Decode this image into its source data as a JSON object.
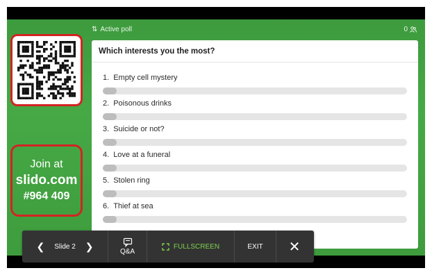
{
  "topbar": {
    "sort_icon": "sort-arrows-icon",
    "status": "Active poll",
    "participant_count": "0",
    "participants_icon": "people-icon"
  },
  "join": {
    "line1": "Join at",
    "line2": "slido.com",
    "line3": "#964 409"
  },
  "poll": {
    "question": "Which interests you the most?",
    "options": [
      {
        "number": "1.",
        "label": "Empty cell mystery",
        "fraction": 0
      },
      {
        "number": "2.",
        "label": "Poisonous drinks",
        "fraction": 0
      },
      {
        "number": "3.",
        "label": "Suicide or not?",
        "fraction": 0
      },
      {
        "number": "4.",
        "label": "Love at a funeral",
        "fraction": 0
      },
      {
        "number": "5.",
        "label": "Stolen ring",
        "fraction": 0
      },
      {
        "number": "6.",
        "label": "Thief at sea",
        "fraction": 0
      }
    ]
  },
  "controls": {
    "prev_icon": "chevron-left-icon",
    "slide_label": "Slide 2",
    "next_icon": "chevron-right-icon",
    "qa_label": "Q&A",
    "fullscreen_label": "FULLSCREEN",
    "exit_label": "EXIT",
    "close_icon": "close-icon"
  },
  "colors": {
    "slide_green": "#46a945",
    "highlight_red": "#d42323",
    "fullscreen_green": "#7ed24c",
    "control_bar": "#333333"
  }
}
